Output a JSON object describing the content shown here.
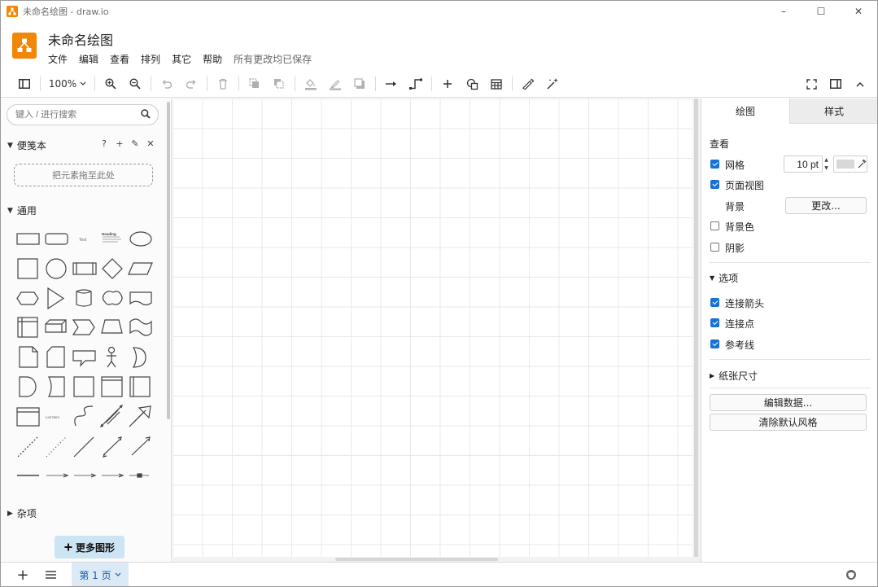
{
  "window": {
    "title": "未命名绘图 - draw.io",
    "minimize": "–",
    "maximize": "☐",
    "close": "✕"
  },
  "header": {
    "doc_title": "未命名绘图",
    "menus": [
      "文件",
      "编辑",
      "查看",
      "排列",
      "其它",
      "帮助"
    ],
    "save_status": "所有更改均已保存"
  },
  "toolbar": {
    "zoom": "100%"
  },
  "sidebar": {
    "search_placeholder": "键入 / 进行搜索",
    "scratchpad_title": "便笺本",
    "scratchpad_tools": [
      "?",
      "+",
      "✎",
      "✕"
    ],
    "scratchpad_drop": "把元素拖至此处",
    "general_title": "通用",
    "misc_title": "杂项",
    "more_shapes": "更多图形",
    "text_shape_label": "Text",
    "heading_shape_label": "Heading",
    "list_item_label": "List Item"
  },
  "format_panel": {
    "tab_diagram": "绘图",
    "tab_style": "样式",
    "view_heading": "查看",
    "grid_label": "网格",
    "grid_checked": true,
    "grid_size": "10 pt",
    "page_view_label": "页面视图",
    "page_view_checked": true,
    "background_label": "背景",
    "change_button": "更改...",
    "background_color_label": "背景色",
    "background_color_checked": false,
    "shadow_label": "阴影",
    "shadow_checked": false,
    "options_heading": "选项",
    "connection_arrows_label": "连接箭头",
    "connection_arrows_checked": true,
    "connection_points_label": "连接点",
    "connection_points_checked": true,
    "guides_label": "参考线",
    "guides_checked": true,
    "paper_size_heading": "纸张尺寸",
    "edit_data_button": "编辑数据...",
    "clear_style_button": "清除默认风格",
    "grid_color": "#d8d8d8"
  },
  "bottom": {
    "add_page": "+",
    "page_tab": "第 1 页"
  },
  "colors": {
    "accent": "#f08705",
    "checkbox": "#1672d6",
    "page_tab_bg": "#dce9f7",
    "more_shapes_bg": "#cde4f5"
  }
}
